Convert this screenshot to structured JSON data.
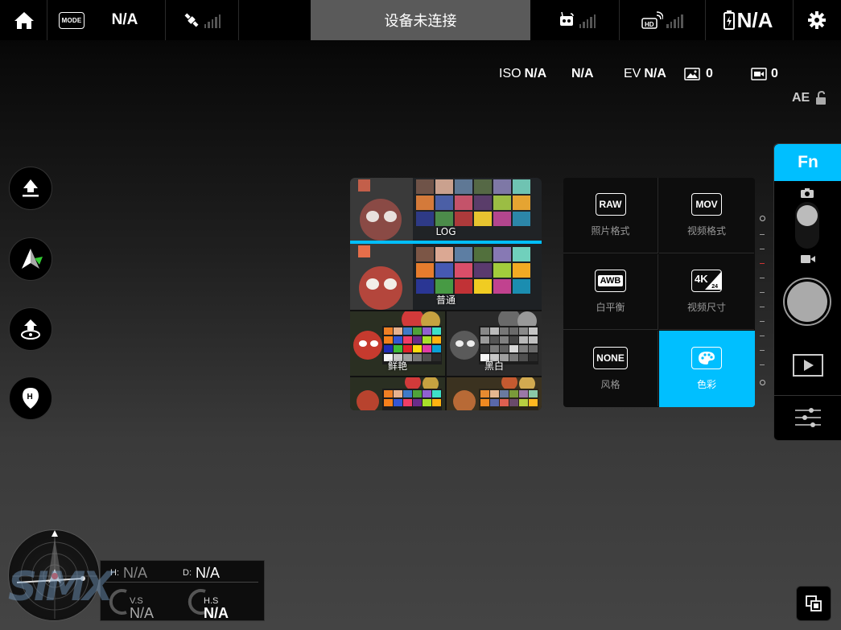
{
  "topbar": {
    "mode_badge": "MODE",
    "mode_value": "N/A",
    "connection_status": "设备未连接",
    "battery_value": "N/A"
  },
  "camera_info": {
    "iso_label": "ISO",
    "iso_value": "N/A",
    "shutter_value": "N/A",
    "ev_label": "EV",
    "ev_value": "N/A",
    "photo_count": "0",
    "video_count": "0",
    "ae_label": "AE"
  },
  "color_styles": {
    "items": [
      {
        "label": "LOG"
      },
      {
        "label": "普通"
      },
      {
        "label": "鲜艳"
      },
      {
        "label": "黑白"
      }
    ],
    "selected": "LOG"
  },
  "settings_panel": {
    "cells": [
      {
        "icon": "RAW",
        "label": "照片格式"
      },
      {
        "icon": "MOV",
        "label": "视频格式"
      },
      {
        "icon": "AWB",
        "label": "白平衡"
      },
      {
        "icon": "4K",
        "icon_sub": "24",
        "label": "视频尺寸"
      },
      {
        "icon": "NONE",
        "label": "风格"
      },
      {
        "icon": "palette-icon",
        "label": "色彩"
      }
    ],
    "active": "色彩"
  },
  "right_panel": {
    "fn_label": "Fn"
  },
  "telemetry": {
    "h_label": "H:",
    "h_value": "N/A",
    "d_label": "D:",
    "d_value": "N/A",
    "vs_label": "V.S",
    "vs_value": "N/A",
    "hs_label": "H.S",
    "hs_value": "N/A"
  },
  "colors": {
    "accent": "#00bfff",
    "status_bg": "#5a5a5a",
    "panel_bg": "#0d0d0d"
  }
}
